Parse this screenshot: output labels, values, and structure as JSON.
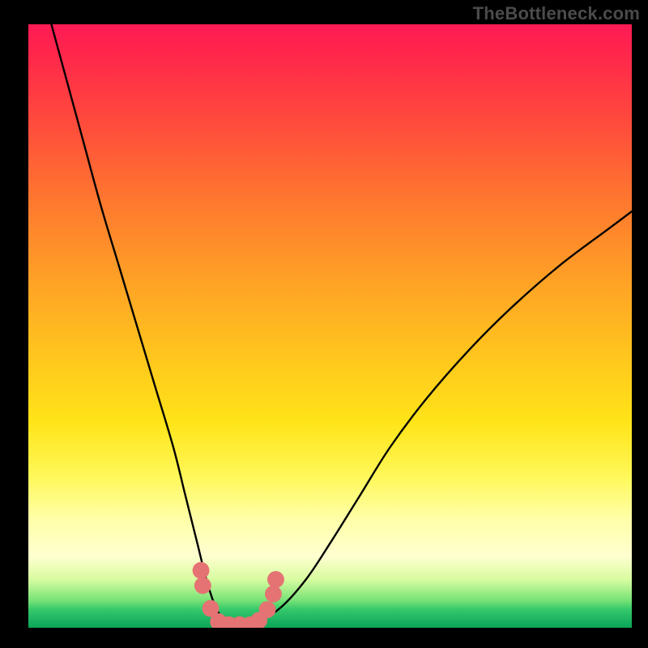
{
  "watermark": "TheBottleneck.com",
  "chart_data": {
    "type": "line",
    "title": "",
    "xlabel": "",
    "ylabel": "",
    "xlim": [
      0,
      100
    ],
    "ylim": [
      0,
      100
    ],
    "grid": false,
    "legend": false,
    "series": [
      {
        "name": "bottleneck-curve",
        "color": "#000000",
        "x": [
          3,
          6,
          9,
          12,
          15,
          18,
          21,
          24,
          26,
          28,
          29.5,
          31,
          32.5,
          34,
          36,
          38.5,
          42,
          46,
          50,
          55,
          60,
          66,
          73,
          80,
          88,
          96,
          100
        ],
        "values": [
          103,
          92,
          81,
          70,
          60,
          50,
          40,
          30,
          22,
          14,
          8,
          3.5,
          1.2,
          0.4,
          0.4,
          1.2,
          3.5,
          8,
          14,
          22,
          30,
          38,
          46,
          53,
          60,
          66,
          69
        ]
      }
    ],
    "marker_clusters": [
      {
        "name": "bottom-markers",
        "color": "#e57373",
        "radius_pct": 1.4,
        "points": [
          {
            "x": 28.6,
            "y": 9.5
          },
          {
            "x": 28.9,
            "y": 7.0
          },
          {
            "x": 30.2,
            "y": 3.2
          },
          {
            "x": 31.5,
            "y": 1.0
          },
          {
            "x": 33.2,
            "y": 0.5
          },
          {
            "x": 35.0,
            "y": 0.5
          },
          {
            "x": 36.8,
            "y": 0.5
          },
          {
            "x": 38.2,
            "y": 1.2
          },
          {
            "x": 39.6,
            "y": 3.0
          },
          {
            "x": 40.6,
            "y": 5.6
          },
          {
            "x": 41.0,
            "y": 8.0
          }
        ]
      }
    ]
  }
}
